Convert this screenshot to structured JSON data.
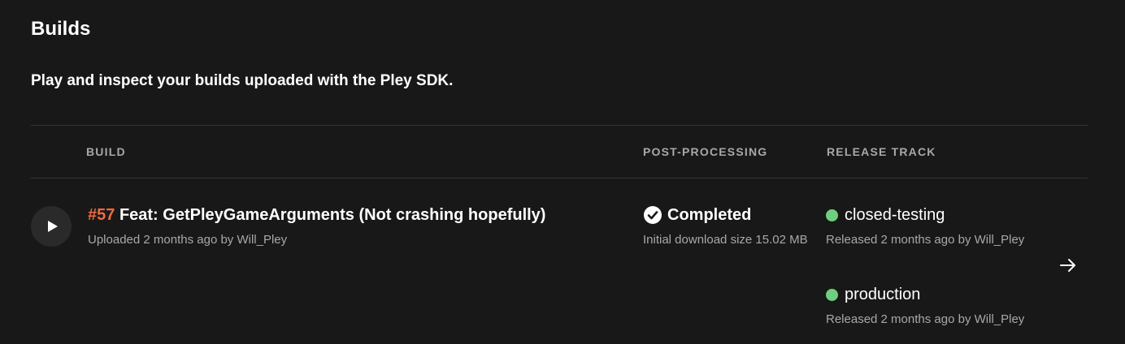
{
  "page": {
    "title": "Builds",
    "subtitle": "Play and inspect your builds uploaded with the Pley SDK."
  },
  "table": {
    "columns": {
      "build": "BUILD",
      "post_processing": "POST-PROCESSING",
      "release_track": "RELEASE TRACK"
    },
    "rows": [
      {
        "build_number": "#57",
        "build_name": "Feat: GetPleyGameArguments (Not crashing hopefully)",
        "uploaded": "Uploaded 2 months ago by Will_Pley",
        "status": "Completed",
        "status_icon": "check-circle-icon",
        "download_size": "Initial download size 15.02 MB",
        "tracks": [
          {
            "name": "closed-testing",
            "released": "Released 2 months ago by Will_Pley",
            "dot_color": "#6fcf7f"
          },
          {
            "name": "production",
            "released": "Released 2 months ago by Will_Pley",
            "dot_color": "#6fcf7f"
          }
        ]
      }
    ]
  },
  "colors": {
    "background": "#181818",
    "accent_build_number": "#f06a3f",
    "status_ok": "#6fcf7f"
  }
}
